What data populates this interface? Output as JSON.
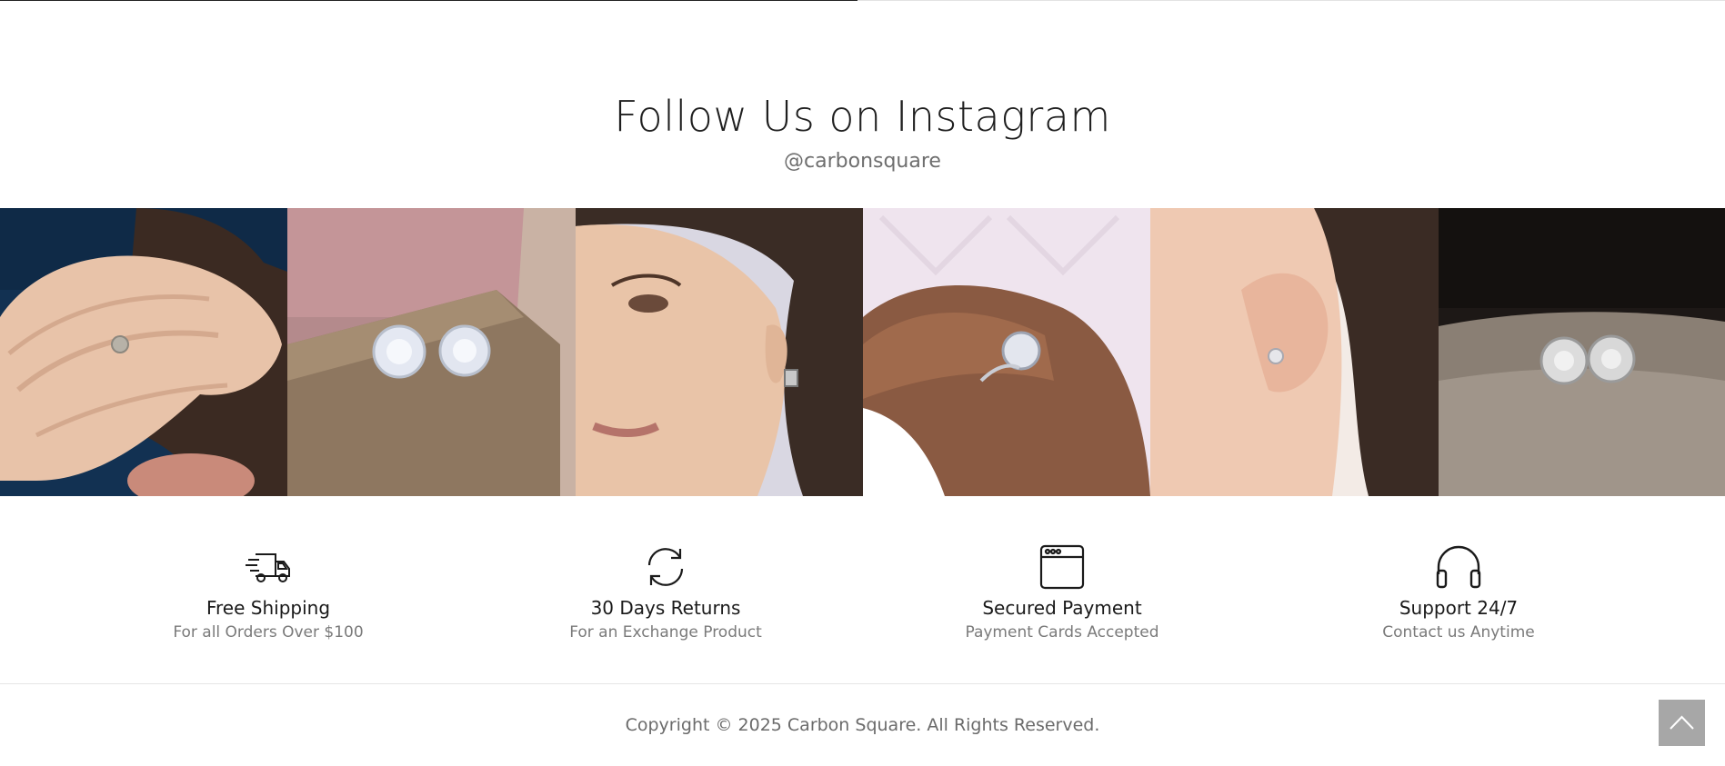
{
  "instagram": {
    "heading": "Follow Us on Instagram",
    "handle": "@carbonsquare",
    "tiles": [
      {
        "subject": "hands-ring-photo"
      },
      {
        "subject": "stud-earrings-on-box-photo"
      },
      {
        "subject": "woman-earring-portrait-photo"
      },
      {
        "subject": "solitaire-ring-hand-photo"
      },
      {
        "subject": "ear-stud-photo"
      },
      {
        "subject": "stud-pair-closeup-photo"
      }
    ]
  },
  "features": [
    {
      "title": "Free Shipping",
      "subtitle": "For all Orders Over $100",
      "icon": "delivery-truck-icon"
    },
    {
      "title": "30 Days Returns",
      "subtitle": "For an Exchange Product",
      "icon": "return-arrows-icon"
    },
    {
      "title": "Secured Payment",
      "subtitle": "Payment Cards Accepted",
      "icon": "browser-window-icon"
    },
    {
      "title": "Support 24/7",
      "subtitle": "Contact us Anytime",
      "icon": "headphones-icon"
    }
  ],
  "footer": {
    "copyright": "Copyright © 2025 Carbon Square. All Rights Reserved."
  },
  "back_to_top": {
    "icon": "chevron-up-icon"
  }
}
